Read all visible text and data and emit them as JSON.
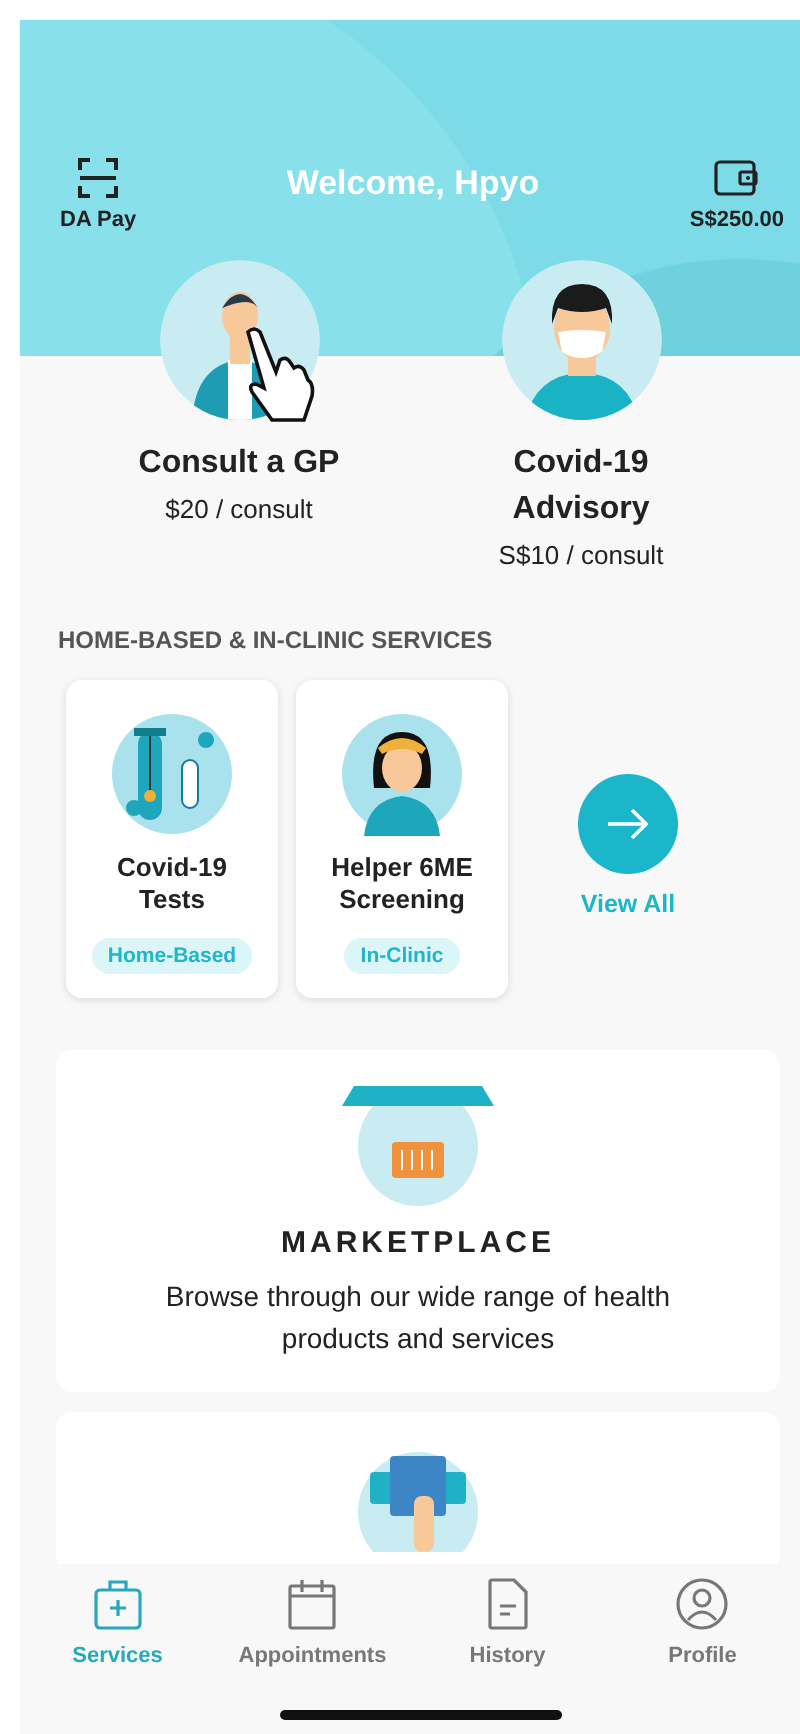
{
  "header": {
    "pay_label": "DA Pay",
    "greeting": "Welcome, Hpyo",
    "wallet_balance": "S$250.00"
  },
  "consults": [
    {
      "title": "Consult a GP",
      "price": "$20 / consult",
      "kind": "doctor"
    },
    {
      "title": "Covid-19 Advisory",
      "price": "S$10 / consult",
      "kind": "masked"
    }
  ],
  "section_title": "HOME-BASED & IN-CLINIC SERVICES",
  "services": [
    {
      "title": "Covid-19 Tests",
      "tag": "Home-Based",
      "kind": "test"
    },
    {
      "title": "Helper 6ME Screening",
      "tag": "In-Clinic",
      "kind": "helper"
    }
  ],
  "view_all": "View All",
  "marketplace": {
    "title": "MARKETPLACE",
    "description": "Browse through our wide range of health products and services"
  },
  "tabs": [
    {
      "label": "Services",
      "kind": "kit",
      "selected": true
    },
    {
      "label": "Appointments",
      "kind": "calendar",
      "selected": false
    },
    {
      "label": "History",
      "kind": "document",
      "selected": false
    },
    {
      "label": "Profile",
      "kind": "person",
      "selected": false
    }
  ]
}
